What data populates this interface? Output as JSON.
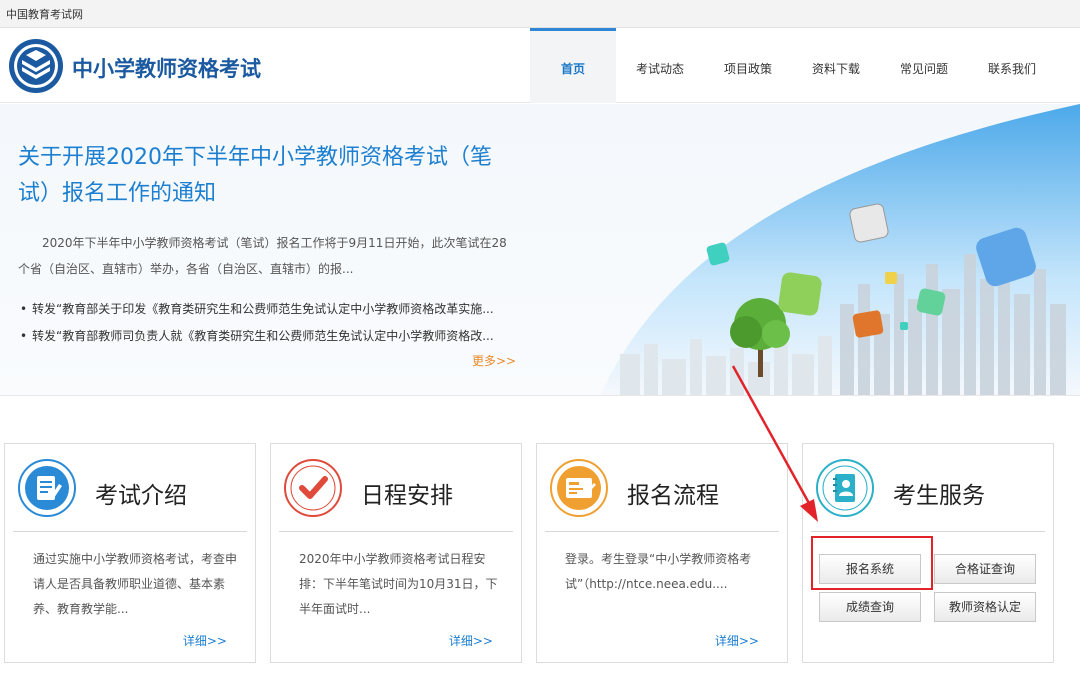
{
  "topbar": {
    "site_name": "中国教育考试网"
  },
  "header": {
    "title": "中小学教师资格考试",
    "nav": [
      {
        "label": "首页",
        "active": true
      },
      {
        "label": "考试动态",
        "active": false
      },
      {
        "label": "项目政策",
        "active": false
      },
      {
        "label": "资料下载",
        "active": false
      },
      {
        "label": "常见问题",
        "active": false
      },
      {
        "label": "联系我们",
        "active": false
      }
    ]
  },
  "news": {
    "headline": "关于开展2020年下半年中小学教师资格考试（笔试）报名工作的通知",
    "summary": "2020年下半年中小学教师资格考试（笔试）报名工作将于9月11日开始，此次笔试在28个省（自治区、直辖市）举办，各省（自治区、直辖市）的报...",
    "links": [
      "转发“教育部关于印发《教育类研究生和公费师范生免试认定中小学教师资格改革实施...",
      "转发“教育部教师司负责人就《教育类研究生和公费师范生免试认定中小学教师资格改..."
    ],
    "more": "更多>>"
  },
  "cards": [
    {
      "title": "考试介绍",
      "icon": "document-icon",
      "text": "通过实施中小学教师资格考试，考查申请人是否具备教师职业道德、基本素养、教育教学能...",
      "more": "详细>>"
    },
    {
      "title": "日程安排",
      "icon": "checkmark-icon",
      "text": "2020年中小学教师资格考试日程安排：下半年笔试时间为10月31日，下半年面试时...",
      "more": "详细>>"
    },
    {
      "title": "报名流程",
      "icon": "form-icon",
      "text": "登录。考生登录“中小学教师资格考试”（http://ntce.neea.edu....",
      "more": "详细>>"
    }
  ],
  "services": {
    "title": "考生服务",
    "icon": "contact-book-icon",
    "buttons": [
      "报名系统",
      "合格证查询",
      "成绩查询",
      "教师资格认定"
    ]
  },
  "colors": {
    "brand_blue": "#1b5aa0",
    "link_blue": "#1d7fd0",
    "accent_orange": "#e98b2b",
    "highlight_red": "#e2232a"
  }
}
